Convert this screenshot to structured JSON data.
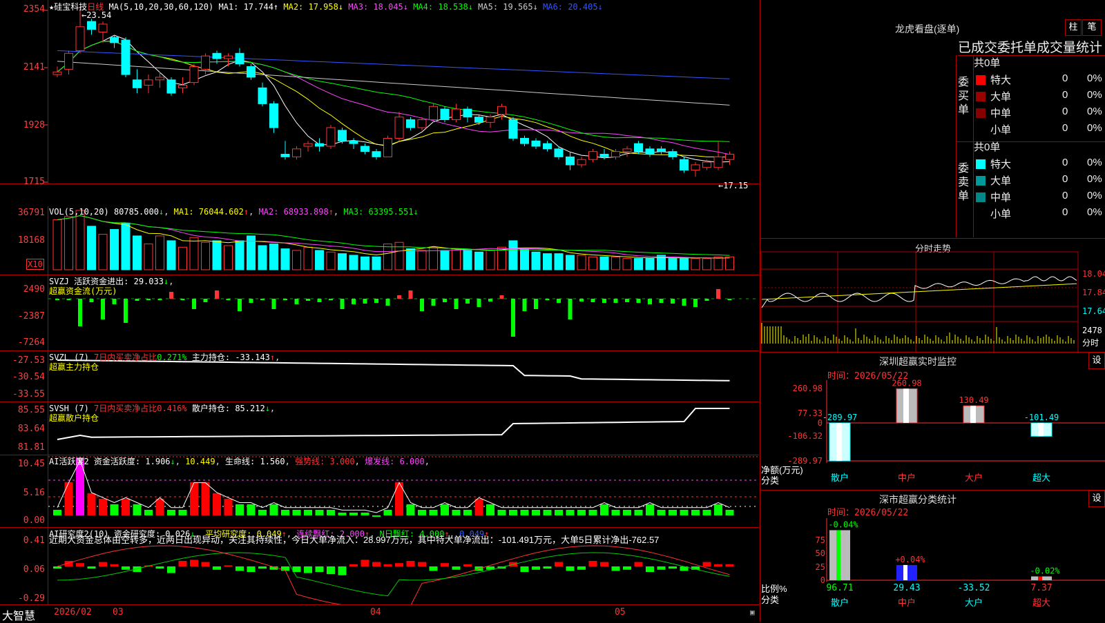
{
  "stock": {
    "name": "硅宝科技",
    "period": "日线",
    "ma_label": "MA(5,10,20,30,60,120)"
  },
  "price_pane": {
    "ma": [
      {
        "label": "MA1:",
        "value": "17.744",
        "arrow": "↑",
        "color": "#ffffff"
      },
      {
        "label": "MA2:",
        "value": "17.958",
        "arrow": "↓",
        "color": "#ffff00"
      },
      {
        "label": "MA3:",
        "value": "18.045",
        "arrow": "↓",
        "color": "#ff44ff"
      },
      {
        "label": "MA4:",
        "value": "18.538",
        "arrow": "↓",
        "color": "#00ff00"
      },
      {
        "label": "MA5:",
        "value": "19.565",
        "arrow": "↓",
        "color": "#cccccc"
      },
      {
        "label": "MA6:",
        "value": "20.405",
        "arrow": "↓",
        "color": "#3355ff"
      }
    ],
    "y_ticks": [
      "2354",
      "2141",
      "1928",
      "1715"
    ],
    "high_label": "23.54",
    "low_label": "←17.15"
  },
  "vol_pane": {
    "title": "VOL(5,10,20)",
    "value": "80785.000",
    "arrow": "↓",
    "ma": [
      {
        "label": "MA1:",
        "value": "76044.602",
        "arrow": "↑"
      },
      {
        "label": "MA2:",
        "value": "68933.898",
        "arrow": "↑"
      },
      {
        "label": "MA3:",
        "value": "63395.551",
        "arrow": "↓"
      }
    ],
    "y_ticks": [
      "36791",
      "18168"
    ],
    "unit": "X10"
  },
  "svzj_pane": {
    "title": "SVZJ",
    "item": "活跃资金进出:",
    "value": "29.033",
    "arrow": "↓",
    "sub": "超赢资金流(万元)",
    "y_ticks": [
      "2490",
      "-2387",
      "-7264"
    ]
  },
  "svzl_pane": {
    "title": "SVZL (7)",
    "ratio_label": "7日内买卖净占比",
    "ratio": "0.271%",
    "item": "主力持仓:",
    "value": "-33.143",
    "arrow": "↑",
    "sub": "超赢主力持仓",
    "y_ticks": [
      "-27.53",
      "-30.54",
      "-33.55"
    ]
  },
  "svsh_pane": {
    "title": "SVSH (7)",
    "ratio_label": "7日内买卖净占比",
    "ratio": "0.416%",
    "item": "散户持仓:",
    "value": "85.212",
    "arrow": "↓",
    "sub": "超赢散户持仓",
    "y_ticks": [
      "85.55",
      "83.64",
      "81.81"
    ]
  },
  "ai_act_pane": {
    "title": "AI活跃度2",
    "item": "资金活跃度:",
    "value": "1.906",
    "arrow": "↓",
    "v2": "10.449",
    "life_label": "生命线:",
    "life": "1.560",
    "strong_label": "强势线:",
    "strong": "3.000",
    "burst_label": "爆发线:",
    "burst": "6.000",
    "y_ticks": [
      "10.45",
      "5.16",
      "0.00"
    ]
  },
  "ai_res_pane": {
    "title": "AI研究度2(10)",
    "item": "资金研究度:",
    "value": "0.026",
    "arrow": "↓",
    "avg_label": "平均研究度:",
    "avg": "0.049",
    "avg_arrow": "↑",
    "lx_label": "连续飘红:",
    "lx": "2.000",
    "lx_arrow": "↑",
    "n_label": "N日飘红:",
    "n": "4.000",
    "n_arrow": "↑",
    "last": "0.049",
    "last_arrow": "↑",
    "commentary": "近期大资金总体由空转多，近两日出现异动，关注其持续性，今日大单净流入：28.997万元，其中特大单净流出：-101.491万元，大单5日累计净出-762.57",
    "y_ticks": [
      "0.41",
      "0.06",
      "-0.29"
    ]
  },
  "x_axis": {
    "labels": [
      "2026/02",
      "03",
      "04",
      "05"
    ],
    "brand": "大智慧"
  },
  "dragon": {
    "title": "龙虎看盘(逐单)",
    "btn1": "柱",
    "btn2": "笔",
    "subtitle": "已成交委托单成交量统计",
    "buy": {
      "side": "委买单",
      "total": "共0单",
      "rows": [
        {
          "label": "特大",
          "n": "0",
          "p": "0%",
          "color": "#ff0000"
        },
        {
          "label": "大单",
          "n": "0",
          "p": "0%",
          "color": "#990000"
        },
        {
          "label": "中单",
          "n": "0",
          "p": "0%",
          "color": "#880000"
        },
        {
          "label": "小单",
          "n": "0",
          "p": "0%",
          "color": "#000000"
        }
      ]
    },
    "sell": {
      "side": "委卖单",
      "total": "共0单",
      "rows": [
        {
          "label": "特大",
          "n": "0",
          "p": "0%",
          "color": "#00ffff"
        },
        {
          "label": "大单",
          "n": "0",
          "p": "0%",
          "color": "#009999"
        },
        {
          "label": "中单",
          "n": "0",
          "p": "0%",
          "color": "#008888"
        },
        {
          "label": "小单",
          "n": "0",
          "p": "0%",
          "color": "#000000"
        }
      ]
    }
  },
  "intraday": {
    "title": "分时走势",
    "y": [
      "18.04",
      "17.84",
      "17.64"
    ],
    "vol": "2478",
    "vol_unit": "分时"
  },
  "monitor": {
    "title": "深圳超赢实时监控",
    "btn": "设",
    "time_label": "时间：",
    "time": "2026/05/22",
    "y": [
      "260.98",
      "77.33",
      "0",
      "-106.32",
      "-289.97"
    ],
    "ylabel": "净额(万元)",
    "xlabel": "分类",
    "cats": [
      "散户",
      "中户",
      "大户",
      "超大"
    ],
    "values": [
      -289.97,
      260.98,
      130.49,
      -101.49
    ],
    "value_labels": [
      "-289.97",
      "260.98",
      "130.49",
      "-101.49"
    ]
  },
  "classify": {
    "title": "深市超赢分类统计",
    "btn": "设",
    "time_label": "时间：",
    "time": "2026/05/22",
    "y": [
      "75",
      "50",
      "25",
      "0"
    ],
    "ylabel": "比例%",
    "xlabel": "分类",
    "cats": [
      "散户",
      "中户",
      "大户",
      "超大"
    ],
    "values": [
      96.71,
      29.43,
      -33.52,
      7.37
    ],
    "value_labels": [
      "96.71",
      "29.43",
      "-33.52",
      "7.37"
    ],
    "change_labels": [
      "-0.04%",
      "+0.04%",
      "",
      "-0.02%"
    ]
  },
  "chart_data": {
    "type": "candlestick",
    "title": "硅宝科技 日线",
    "ylim": [
      17.0,
      23.6
    ],
    "x_labels": [
      "2026/02",
      "03",
      "04",
      "05"
    ],
    "ohlc": [
      [
        21.0,
        21.3,
        20.9,
        21.1
      ],
      [
        21.2,
        21.9,
        21.0,
        21.8
      ],
      [
        21.9,
        23.54,
        21.8,
        22.8
      ],
      [
        23.0,
        23.1,
        22.5,
        22.7
      ],
      [
        22.6,
        23.0,
        22.2,
        22.9
      ],
      [
        22.4,
        22.5,
        22.0,
        22.2
      ],
      [
        22.3,
        22.4,
        20.9,
        21.0
      ],
      [
        20.8,
        21.2,
        20.3,
        20.5
      ],
      [
        20.6,
        21.0,
        20.3,
        20.8
      ],
      [
        20.8,
        21.1,
        20.5,
        20.9
      ],
      [
        20.8,
        20.9,
        20.2,
        20.3
      ],
      [
        20.5,
        20.9,
        20.3,
        20.6
      ],
      [
        20.7,
        21.4,
        20.6,
        21.3
      ],
      [
        21.2,
        21.8,
        21.0,
        21.7
      ],
      [
        21.8,
        21.9,
        21.4,
        21.6
      ],
      [
        21.6,
        21.8,
        21.3,
        21.7
      ],
      [
        21.8,
        22.0,
        21.3,
        21.4
      ],
      [
        21.3,
        21.4,
        20.8,
        20.9
      ],
      [
        20.5,
        20.7,
        19.8,
        19.9
      ],
      [
        19.9,
        20.0,
        18.8,
        19.0
      ],
      [
        18.0,
        18.5,
        17.8,
        17.9
      ],
      [
        17.9,
        18.3,
        17.8,
        18.2
      ],
      [
        18.3,
        18.5,
        18.1,
        18.4
      ],
      [
        18.4,
        18.6,
        18.1,
        18.3
      ],
      [
        18.3,
        19.1,
        18.2,
        19.0
      ],
      [
        18.9,
        19.0,
        18.4,
        18.5
      ],
      [
        18.5,
        18.6,
        18.2,
        18.4
      ],
      [
        18.3,
        18.4,
        18.0,
        18.1
      ],
      [
        18.1,
        18.2,
        17.8,
        17.9
      ],
      [
        17.9,
        18.7,
        17.9,
        18.6
      ],
      [
        18.6,
        19.6,
        18.5,
        19.4
      ],
      [
        19.3,
        19.4,
        18.9,
        19.0
      ],
      [
        19.0,
        19.4,
        18.9,
        19.3
      ],
      [
        19.3,
        19.9,
        19.2,
        19.8
      ],
      [
        19.7,
        19.8,
        19.2,
        19.3
      ],
      [
        19.3,
        19.9,
        19.2,
        19.7
      ],
      [
        19.7,
        19.8,
        19.2,
        19.4
      ],
      [
        19.4,
        19.5,
        19.1,
        19.2
      ],
      [
        19.2,
        19.5,
        19.0,
        19.4
      ],
      [
        19.5,
        19.9,
        19.3,
        19.8
      ],
      [
        19.3,
        19.4,
        18.5,
        18.6
      ],
      [
        18.6,
        18.7,
        18.3,
        18.4
      ],
      [
        18.5,
        18.6,
        18.2,
        18.3
      ],
      [
        18.4,
        18.5,
        18.1,
        18.2
      ],
      [
        18.2,
        18.3,
        17.8,
        17.9
      ],
      [
        17.9,
        18.1,
        17.4,
        17.6
      ],
      [
        17.6,
        17.9,
        17.5,
        17.8
      ],
      [
        17.8,
        18.2,
        17.7,
        18.1
      ],
      [
        18.0,
        18.2,
        17.8,
        17.9
      ],
      [
        17.9,
        18.2,
        17.8,
        18.1
      ],
      [
        18.1,
        18.3,
        17.9,
        18.2
      ],
      [
        18.4,
        18.5,
        18.0,
        18.1
      ],
      [
        18.2,
        18.3,
        17.9,
        18.0
      ],
      [
        18.2,
        18.3,
        18.0,
        18.1
      ],
      [
        18.1,
        18.2,
        17.8,
        17.9
      ],
      [
        17.8,
        17.9,
        17.3,
        17.4
      ],
      [
        17.4,
        17.7,
        17.15,
        17.6
      ],
      [
        17.5,
        17.8,
        17.4,
        17.7
      ],
      [
        17.5,
        18.5,
        17.4,
        17.9
      ],
      [
        17.8,
        18.1,
        17.6,
        18.0
      ]
    ],
    "series": [
      {
        "name": "MA1",
        "color": "#ffffff",
        "values": []
      },
      {
        "name": "MA2",
        "color": "#ffff00",
        "values": []
      },
      {
        "name": "MA3",
        "color": "#ff44ff",
        "values": []
      },
      {
        "name": "MA4",
        "color": "#00ff00",
        "values": []
      },
      {
        "name": "MA5",
        "color": "#cccccc",
        "values": []
      },
      {
        "name": "MA6",
        "color": "#3355ff",
        "values": []
      }
    ],
    "volume": [
      31000,
      33000,
      36791,
      27000,
      22000,
      25000,
      29000,
      21000,
      16000,
      21000,
      18000,
      14000,
      20000,
      17000,
      18000,
      15000,
      18000,
      21000,
      15000,
      16000,
      13000,
      12000,
      14000,
      12000,
      11000,
      10000,
      9000,
      8000,
      8000,
      16000,
      17000,
      13000,
      12000,
      14000,
      12000,
      13000,
      12000,
      11000,
      12000,
      14000,
      18000,
      13000,
      11000,
      10000,
      10000,
      9000,
      9000,
      8000,
      8000,
      8000,
      7000,
      7000,
      7000,
      9000,
      7000,
      7000,
      7000,
      7000,
      8000,
      8000
    ]
  }
}
